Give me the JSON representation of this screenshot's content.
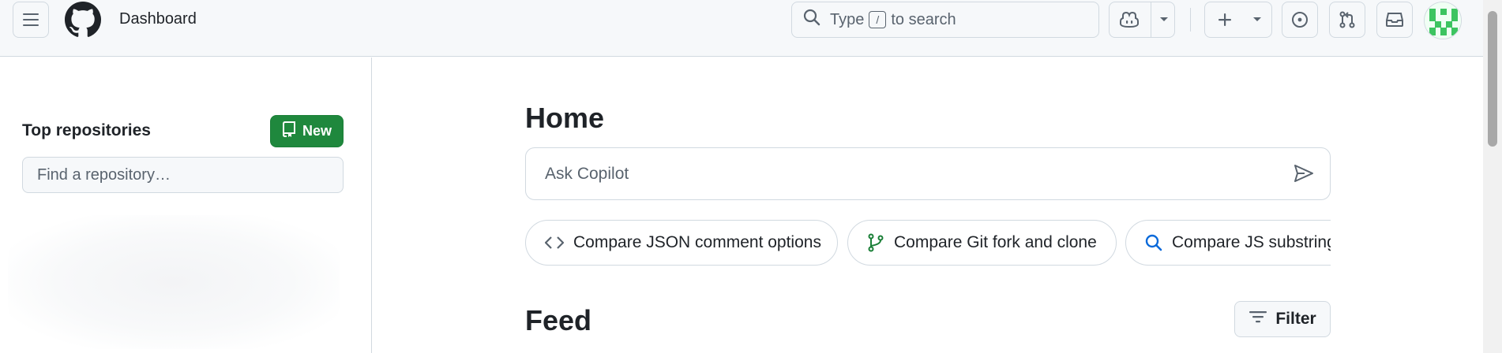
{
  "header": {
    "title": "Dashboard",
    "search": {
      "prefix": "Type",
      "key": "/",
      "suffix": "to search"
    }
  },
  "sidebar": {
    "heading": "Top repositories",
    "new_button": "New",
    "find_placeholder": "Find a repository…"
  },
  "main": {
    "home_title": "Home",
    "copilot_placeholder": "Ask Copilot",
    "suggestions": [
      {
        "label": "Compare JSON comment options",
        "icon": "code-icon"
      },
      {
        "label": "Compare Git fork and clone",
        "icon": "git-branch-icon"
      },
      {
        "label": "Compare JS substring",
        "icon": "search-icon"
      }
    ],
    "feed_title": "Feed",
    "filter_button": "Filter"
  },
  "colors": {
    "accent_green": "#1f883d",
    "border": "#d1d9e0",
    "muted_text": "#59636e",
    "header_bg": "#f6f8fa"
  }
}
